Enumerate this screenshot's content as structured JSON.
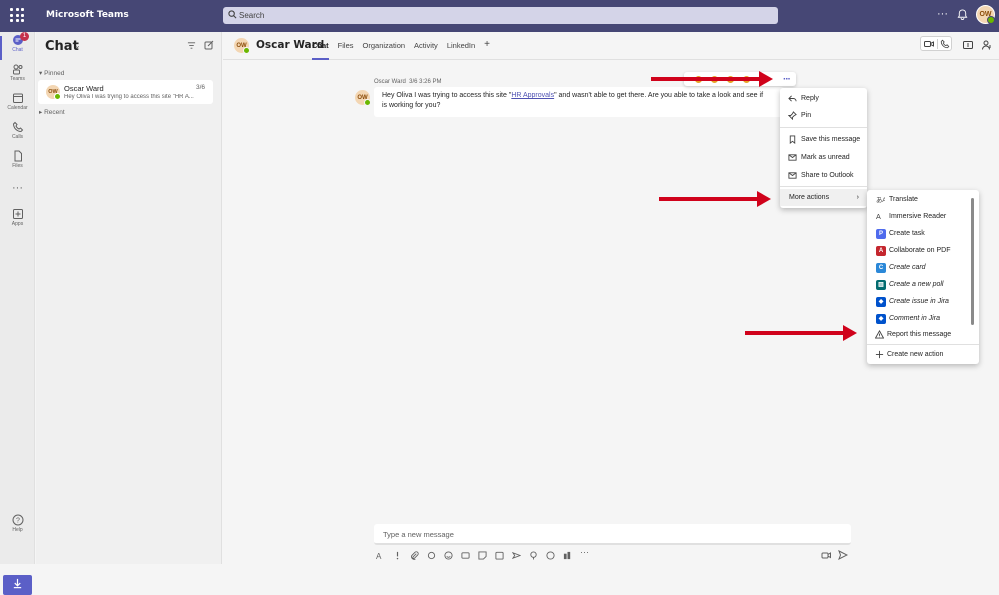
{
  "app": {
    "title": "Microsoft Teams"
  },
  "search": {
    "placeholder": "Search"
  },
  "topbar": {
    "more": "···",
    "avatar": "OW"
  },
  "rail": [
    {
      "label": "Chat",
      "badge": "1"
    },
    {
      "label": "Teams"
    },
    {
      "label": "Calendar"
    },
    {
      "label": "Calls"
    },
    {
      "label": "Files"
    },
    {
      "label": "···"
    },
    {
      "label": "Apps"
    },
    {
      "label": "Help"
    }
  ],
  "chatlist": {
    "title": "Chat",
    "pinned_label": "Pinned",
    "recent_label": "Recent",
    "items": [
      {
        "initials": "OW",
        "name": "Oscar Ward",
        "date": "3/6",
        "preview": "Hey Oliva I was trying to access this site \"HR A..."
      }
    ]
  },
  "header": {
    "initials": "OW",
    "name": "Oscar Ward",
    "tabs": [
      "Chat",
      "Files",
      "Organization",
      "Activity",
      "LinkedIn",
      "+"
    ]
  },
  "message": {
    "sender": "Oscar Ward",
    "time": "3/6 3:26 PM",
    "initials": "OW",
    "text_before": "Hey Oliva I was trying to access this site \"",
    "link": "HR Approvals",
    "text_after": "\" and wasn't able to get there. Are you able to take a look and see if",
    "text_line2": "is working for you?"
  },
  "context_menu": {
    "items": [
      "Reply",
      "Pin",
      "Save this message",
      "Mark as unread",
      "Share to Outlook",
      "More actions"
    ]
  },
  "submenu": {
    "items": [
      {
        "label": "Translate",
        "icon": "translate-icon"
      },
      {
        "label": "Immersive Reader",
        "icon": "immersive-reader-icon"
      },
      {
        "label": "Create task",
        "icon": "planner-icon",
        "color": "#4f6bed"
      },
      {
        "label": "Collaborate on PDF",
        "icon": "pdf-icon",
        "color": "#c4262e"
      },
      {
        "label": "Create card",
        "icon": "card-icon",
        "color": "#2b88d8"
      },
      {
        "label": "Create a new poll",
        "icon": "poll-icon",
        "color": "#036c70"
      },
      {
        "label": "Create issue in Jira",
        "icon": "jira-icon",
        "color": "#0052cc"
      },
      {
        "label": "Comment in Jira",
        "icon": "jira-icon",
        "color": "#0052cc"
      },
      {
        "label": "Report this message",
        "icon": "warning-icon"
      },
      {
        "label": "Create new action",
        "icon": "plus-icon"
      }
    ]
  },
  "compose": {
    "placeholder": "Type a new message"
  },
  "colors": {
    "brand": "#464775",
    "accent": "#5b5fc7",
    "arrow": "#d0021b"
  }
}
